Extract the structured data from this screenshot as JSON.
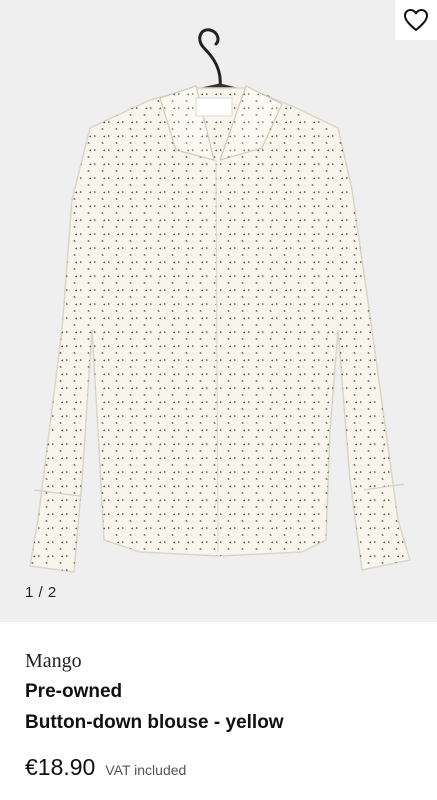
{
  "gallery": {
    "counter": "1 / 2",
    "image_alt": "Pre-owned Button-down blouse - yellow",
    "favorite_icon": "heart-outline-icon"
  },
  "product": {
    "brand": "Mango",
    "condition": "Pre-owned",
    "title": "Button-down blouse - yellow",
    "price": "€18.90",
    "vat_note": "VAT included"
  }
}
